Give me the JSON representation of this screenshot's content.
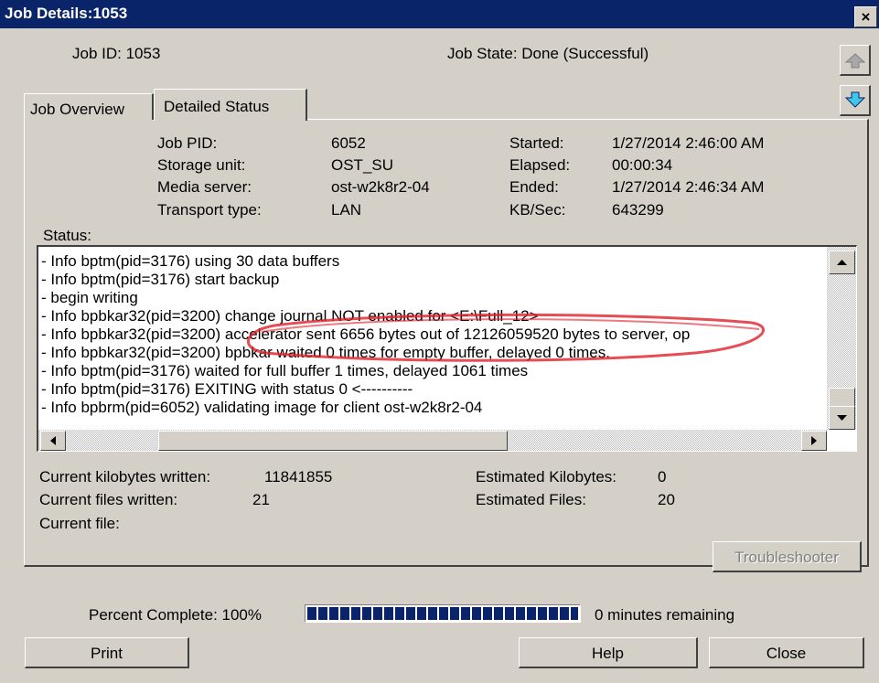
{
  "window": {
    "title": "Job Details:1053",
    "close_label": "×"
  },
  "header": {
    "job_id": "Job ID: 1053",
    "job_state": "Job State: Done (Successful)"
  },
  "tabs": [
    {
      "label": "Job Overview",
      "selected": false
    },
    {
      "label": "Detailed Status",
      "selected": true
    }
  ],
  "details": {
    "labels": [
      "Job PID:",
      "Storage unit:",
      "Media server:",
      "Transport type:"
    ],
    "values": [
      "6052",
      "OST_SU",
      "ost-w2k8r2-04",
      "LAN"
    ],
    "labels2": [
      "Started:",
      "Elapsed:",
      "Ended:",
      "KB/Sec:"
    ],
    "values2": [
      "1/27/2014 2:46:00 AM",
      "00:00:34",
      "1/27/2014 2:46:34 AM",
      "643299"
    ]
  },
  "status": {
    "label": "Status:",
    "lines": [
      "- Info bptm(pid=3176) using 30 data buffers",
      "- Info bptm(pid=3176) start backup",
      "- begin writing",
      "- Info bpbkar32(pid=3200) change journal NOT enabled for <E:\\Full_12>",
      "- Info bpbkar32(pid=3200) accelerator sent 6656 bytes out of 12126059520 bytes to server, op",
      "- Info bpbkar32(pid=3200) bpbkar waited 0 times for empty buffer, delayed 0 times.",
      "- Info bptm(pid=3176) waited for full buffer 1 times, delayed 1061 times",
      "- Info bptm(pid=3176) EXITING with status 0 <----------",
      "- Info bpbrm(pid=6052) validating image for client ost-w2k8r2-04"
    ]
  },
  "stats": {
    "kb_written_label": "Current kilobytes written:",
    "kb_written_value": "11841855",
    "files_written_label": "Current files written:",
    "files_written_value": "21",
    "current_file_label": "Current file:",
    "est_kb_label": "Estimated Kilobytes:",
    "est_kb_value": "0",
    "est_files_label": "Estimated Files:",
    "est_files_value": "20"
  },
  "troubleshooter_label": "Troubleshooter",
  "progress": {
    "label": "Percent Complete: 100%",
    "percent": 100,
    "remaining": "0 minutes remaining"
  },
  "buttons": {
    "print": "Print",
    "help": "Help",
    "close": "Close"
  },
  "colors": {
    "titlebar": "#0a246a",
    "annotation": "#e0202a",
    "dialog": "#d4d0c8"
  }
}
